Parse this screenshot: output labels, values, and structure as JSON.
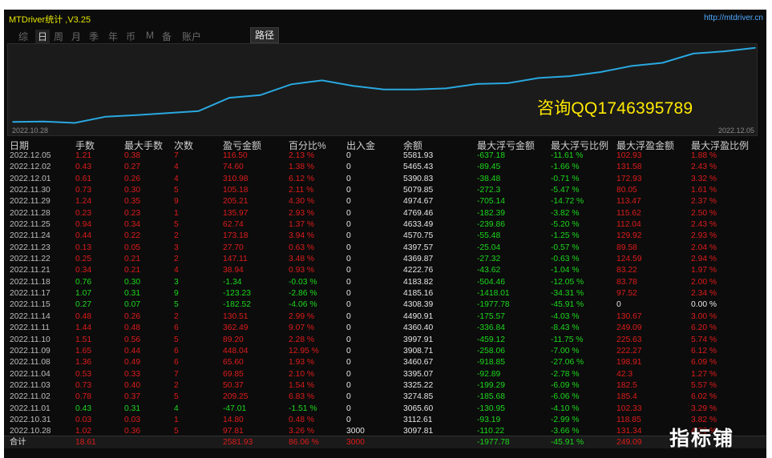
{
  "title": "MTDriver统计 ,V3.25",
  "url": "http://mtdriver.cn",
  "nav": [
    "综",
    "日",
    "周",
    "月",
    "季",
    "年",
    "币",
    "M",
    "备",
    "账户"
  ],
  "nav_active": 1,
  "path_button": "路径",
  "watermark": "咨询QQ1746395789",
  "brand": "指标铺",
  "chart_data": {
    "type": "line",
    "x_start": "2022.10.28",
    "x_end": "2022.12.05",
    "x": [
      "2022.10.28",
      "2022.10.31",
      "2022.11.01",
      "2022.11.02",
      "2022.11.03",
      "2022.11.04",
      "2022.11.08",
      "2022.11.09",
      "2022.11.10",
      "2022.11.11",
      "2022.11.14",
      "2022.11.15",
      "2022.11.17",
      "2022.11.18",
      "2022.11.21",
      "2022.11.22",
      "2022.11.23",
      "2022.11.24",
      "2022.11.25",
      "2022.11.28",
      "2022.11.29",
      "2022.11.30",
      "2022.12.01",
      "2022.12.02",
      "2022.12.05"
    ],
    "values": [
      3097.81,
      3112.61,
      3065.6,
      3274.85,
      3325.22,
      3395.07,
      3460.67,
      3908.71,
      3997.91,
      4360.4,
      4490.91,
      4308.39,
      4185.16,
      4183.82,
      4222.76,
      4369.87,
      4397.57,
      4570.75,
      4633.49,
      4769.46,
      4974.67,
      5079.85,
      5390.83,
      5465.43,
      5581.93
    ],
    "color": "#29a8e0",
    "grid": false
  },
  "columns": [
    "日期",
    "手数",
    "最大手数",
    "次数",
    "盈亏金额",
    "百分比%",
    "出入金",
    "余额",
    "最大浮亏金额",
    "最大浮亏比例",
    "最大浮盈金额",
    "最大浮盈比例"
  ],
  "rows": [
    {
      "date": "2022.12.05",
      "lots": "1.21",
      "max_lots": "0.38",
      "count": "7",
      "pnl": "116.50",
      "pct": "2.13 %",
      "io": "0",
      "bal": "5581.93",
      "mfl": "-637.18",
      "mflp": "-11.61 %",
      "mfp": "102.93",
      "mfpp": "1.88 %",
      "neg": false
    },
    {
      "date": "2022.12.02",
      "lots": "0.43",
      "max_lots": "0.27",
      "count": "4",
      "pnl": "74.60",
      "pct": "1.38 %",
      "io": "0",
      "bal": "5465.43",
      "mfl": "-89.45",
      "mflp": "-1.66 %",
      "mfp": "131.58",
      "mfpp": "2.43 %",
      "neg": false
    },
    {
      "date": "2022.12.01",
      "lots": "0.61",
      "max_lots": "0.26",
      "count": "4",
      "pnl": "310.98",
      "pct": "6.12 %",
      "io": "0",
      "bal": "5390.83",
      "mfl": "-38.48",
      "mflp": "-0.71 %",
      "mfp": "172.93",
      "mfpp": "3.32 %",
      "neg": false
    },
    {
      "date": "2022.11.30",
      "lots": "0.73",
      "max_lots": "0.30",
      "count": "5",
      "pnl": "105.18",
      "pct": "2.11 %",
      "io": "0",
      "bal": "5079.85",
      "mfl": "-272.3",
      "mflp": "-5.47 %",
      "mfp": "80.05",
      "mfpp": "1.61 %",
      "neg": false
    },
    {
      "date": "2022.11.29",
      "lots": "1.24",
      "max_lots": "0.35",
      "count": "9",
      "pnl": "205.21",
      "pct": "4.30 %",
      "io": "0",
      "bal": "4974.67",
      "mfl": "-705.14",
      "mflp": "-14.72 %",
      "mfp": "113.47",
      "mfpp": "2.37 %",
      "neg": false
    },
    {
      "date": "2022.11.28",
      "lots": "0.23",
      "max_lots": "0.23",
      "count": "1",
      "pnl": "135.97",
      "pct": "2.93 %",
      "io": "0",
      "bal": "4769.46",
      "mfl": "-182.39",
      "mflp": "-3.82 %",
      "mfp": "115.62",
      "mfpp": "2.50 %",
      "neg": false
    },
    {
      "date": "2022.11.25",
      "lots": "0.94",
      "max_lots": "0.34",
      "count": "5",
      "pnl": "62.74",
      "pct": "1.37 %",
      "io": "0",
      "bal": "4633.49",
      "mfl": "-239.86",
      "mflp": "-5.20 %",
      "mfp": "112.04",
      "mfpp": "2.43 %",
      "neg": false
    },
    {
      "date": "2022.11.24",
      "lots": "0.44",
      "max_lots": "0.22",
      "count": "2",
      "pnl": "173.18",
      "pct": "3.94 %",
      "io": "0",
      "bal": "4570.75",
      "mfl": "-55.48",
      "mflp": "-1.25 %",
      "mfp": "129.92",
      "mfpp": "2.93 %",
      "neg": false
    },
    {
      "date": "2022.11.23",
      "lots": "0.13",
      "max_lots": "0.05",
      "count": "3",
      "pnl": "27.70",
      "pct": "0.63 %",
      "io": "0",
      "bal": "4397.57",
      "mfl": "-25.04",
      "mflp": "-0.57 %",
      "mfp": "89.58",
      "mfpp": "2.04 %",
      "neg": false
    },
    {
      "date": "2022.11.22",
      "lots": "0.25",
      "max_lots": "0.21",
      "count": "2",
      "pnl": "147.11",
      "pct": "3.48 %",
      "io": "0",
      "bal": "4369.87",
      "mfl": "-27.32",
      "mflp": "-0.63 %",
      "mfp": "124.59",
      "mfpp": "2.94 %",
      "neg": false
    },
    {
      "date": "2022.11.21",
      "lots": "0.34",
      "max_lots": "0.21",
      "count": "4",
      "pnl": "38.94",
      "pct": "0.93 %",
      "io": "0",
      "bal": "4222.76",
      "mfl": "-43.62",
      "mflp": "-1.04 %",
      "mfp": "83.22",
      "mfpp": "1.97 %",
      "neg": false
    },
    {
      "date": "2022.11.18",
      "lots": "0.76",
      "max_lots": "0.30",
      "count": "3",
      "pnl": "-1.34",
      "pct": "-0.03 %",
      "io": "0",
      "bal": "4183.82",
      "mfl": "-504.46",
      "mflp": "-12.05 %",
      "mfp": "83.78",
      "mfpp": "2.00 %",
      "neg": true
    },
    {
      "date": "2022.11.17",
      "lots": "1.07",
      "max_lots": "0.31",
      "count": "9",
      "pnl": "-123.23",
      "pct": "-2.86 %",
      "io": "0",
      "bal": "4185.16",
      "mfl": "-1418.01",
      "mflp": "-34.31 %",
      "mfp": "97.52",
      "mfpp": "2.34 %",
      "neg": true
    },
    {
      "date": "2022.11.15",
      "lots": "0.27",
      "max_lots": "0.07",
      "count": "5",
      "pnl": "-182.52",
      "pct": "-4.06 %",
      "io": "0",
      "bal": "4308.39",
      "mfl": "-1977.78",
      "mflp": "-45.91 %",
      "mfp": "0",
      "mfpp": "0.00 %",
      "neg": true,
      "zero": true
    },
    {
      "date": "2022.11.14",
      "lots": "0.48",
      "max_lots": "0.26",
      "count": "2",
      "pnl": "130.51",
      "pct": "2.99 %",
      "io": "0",
      "bal": "4490.91",
      "mfl": "-175.57",
      "mflp": "-4.03 %",
      "mfp": "130.67",
      "mfpp": "3.00 %",
      "neg": false
    },
    {
      "date": "2022.11.11",
      "lots": "1.44",
      "max_lots": "0.48",
      "count": "6",
      "pnl": "362.49",
      "pct": "9.07 %",
      "io": "0",
      "bal": "4360.40",
      "mfl": "-336.84",
      "mflp": "-8.43 %",
      "mfp": "249.09",
      "mfpp": "6.20 %",
      "neg": false
    },
    {
      "date": "2022.11.10",
      "lots": "1.51",
      "max_lots": "0.56",
      "count": "5",
      "pnl": "89.20",
      "pct": "2.28 %",
      "io": "0",
      "bal": "3997.91",
      "mfl": "-459.12",
      "mflp": "-11.75 %",
      "mfp": "225.63",
      "mfpp": "5.74 %",
      "neg": false
    },
    {
      "date": "2022.11.09",
      "lots": "1.65",
      "max_lots": "0.44",
      "count": "6",
      "pnl": "448.04",
      "pct": "12.95 %",
      "io": "0",
      "bal": "3908.71",
      "mfl": "-258.06",
      "mflp": "-7.00 %",
      "mfp": "222.27",
      "mfpp": "6.12 %",
      "neg": false
    },
    {
      "date": "2022.11.08",
      "lots": "1.36",
      "max_lots": "0.49",
      "count": "6",
      "pnl": "65.60",
      "pct": "1.93 %",
      "io": "0",
      "bal": "3460.67",
      "mfl": "-918.85",
      "mflp": "-27.06 %",
      "mfp": "198.91",
      "mfpp": "6.09 %",
      "neg": false
    },
    {
      "date": "2022.11.04",
      "lots": "0.53",
      "max_lots": "0.33",
      "count": "7",
      "pnl": "69.85",
      "pct": "2.10 %",
      "io": "0",
      "bal": "3395.07",
      "mfl": "-92.89",
      "mflp": "-2.78 %",
      "mfp": "42.3",
      "mfpp": "1.27 %",
      "neg": false
    },
    {
      "date": "2022.11.03",
      "lots": "0.73",
      "max_lots": "0.40",
      "count": "2",
      "pnl": "50.37",
      "pct": "1.54 %",
      "io": "0",
      "bal": "3325.22",
      "mfl": "-199.29",
      "mflp": "-6.09 %",
      "mfp": "182.5",
      "mfpp": "5.57 %",
      "neg": false
    },
    {
      "date": "2022.11.02",
      "lots": "0.78",
      "max_lots": "0.37",
      "count": "5",
      "pnl": "209.25",
      "pct": "6.83 %",
      "io": "0",
      "bal": "3274.85",
      "mfl": "-185.68",
      "mflp": "-6.06 %",
      "mfp": "185.4",
      "mfpp": "6.02 %",
      "neg": false
    },
    {
      "date": "2022.11.01",
      "lots": "0.43",
      "max_lots": "0.31",
      "count": "4",
      "pnl": "-47.01",
      "pct": "-1.51 %",
      "io": "0",
      "bal": "3065.60",
      "mfl": "-130.95",
      "mflp": "-4.10 %",
      "mfp": "102.33",
      "mfpp": "3.29 %",
      "neg": true
    },
    {
      "date": "2022.10.31",
      "lots": "0.03",
      "max_lots": "0.03",
      "count": "1",
      "pnl": "14.80",
      "pct": "0.48 %",
      "io": "0",
      "bal": "3112.61",
      "mfl": "-93.19",
      "mflp": "-2.99 %",
      "mfp": "118.85",
      "mfpp": "3.82 %",
      "neg": false
    },
    {
      "date": "2022.10.28",
      "lots": "1.02",
      "max_lots": "0.36",
      "count": "5",
      "pnl": "97.81",
      "pct": "3.26 %",
      "io": "3000",
      "bal": "3097.81",
      "mfl": "-110.22",
      "mflp": "-3.66 %",
      "mfp": "131.34",
      "mfpp": "4.33 %",
      "neg": false
    }
  ],
  "total": {
    "label": "合计",
    "lots": "18.61",
    "pnl": "2581.93",
    "pct": "86.06 %",
    "io": "3000",
    "mfl": "-1977.78",
    "mflp": "-45.91 %",
    "mfp": "249.09"
  }
}
